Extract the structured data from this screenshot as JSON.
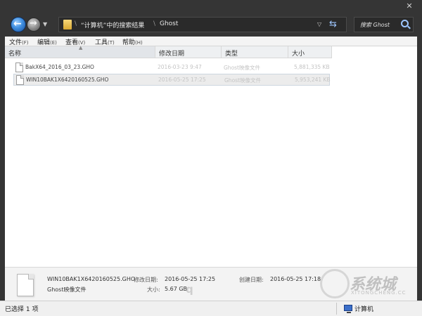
{
  "window": {
    "close_glyph": "✕"
  },
  "address_bar": {
    "crumbs": [
      "“计算机”中的搜索结果",
      "Ghost"
    ],
    "separator": "\\"
  },
  "search": {
    "placeholder": "搜索 Ghost"
  },
  "menubar": [
    {
      "label": "文件",
      "accel": "(F)"
    },
    {
      "label": "编辑",
      "accel": "(E)"
    },
    {
      "label": "查看",
      "accel": "(V)"
    },
    {
      "label": "工具",
      "accel": "(T)"
    },
    {
      "label": "帮助",
      "accel": "(H)"
    }
  ],
  "columns": [
    "名称",
    "修改日期",
    "类型",
    "大小"
  ],
  "files": [
    {
      "name": "BakX64_2016_03_23.GHO",
      "modified": "2016-03-23 9:47",
      "type": "Ghost映像文件",
      "size": "5,881,335 KB",
      "selected": false
    },
    {
      "name": "WIN10BAK1X6420160525.GHO",
      "modified": "2016-05-25 17:25",
      "type": "Ghost映像文件",
      "size": "5,953,241 KB",
      "selected": true
    }
  ],
  "details": {
    "filename": "WIN10BAK1X6420160525.GHO",
    "type": "Ghost映像文件",
    "modified_label": "修改日期:",
    "modified_value": "2016-05-25 17:25",
    "created_label": "创建日期:",
    "created_value": "2016-05-25 17:18",
    "size_label": "大小:",
    "size_value": "5.67 GB"
  },
  "watermark": {
    "brand": "系统城",
    "domain": "XITONGCHENG.CC",
    "mark": "q"
  },
  "statusbar": {
    "left": "已选择 1 项",
    "right": "计算机"
  },
  "icons": [
    "back-arrow-icon",
    "forward-arrow-icon",
    "folder-icon",
    "refresh-icon",
    "search-icon",
    "file-icon",
    "computer-icon",
    "close-icon"
  ]
}
